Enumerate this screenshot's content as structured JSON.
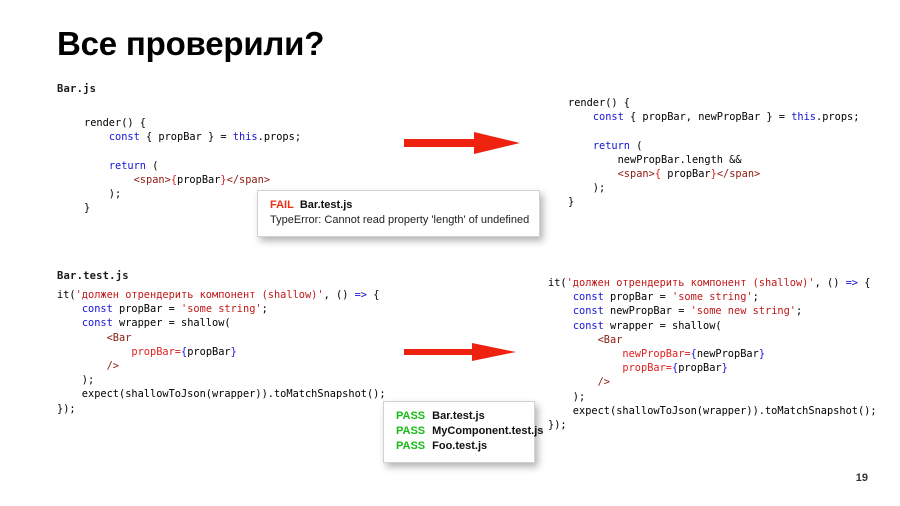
{
  "slide": {
    "title": "Все проверили?",
    "page_number": "19"
  },
  "labels": {
    "bar_js": "Bar.js",
    "bar_test_js": "Bar.test.js"
  },
  "code_blocks": {
    "left_top": {
      "name": "Bar.js original render",
      "lines": [
        "render() {",
        "    const { propBar } = this.props;",
        "",
        "    return (",
        "        <span>{propBar}</span>",
        "    );",
        "}"
      ]
    },
    "right_top": {
      "name": "Bar.js fixed render",
      "lines": [
        "render() {",
        "    const { propBar, newPropBar } = this.props;",
        "",
        "    return (",
        "        newPropBar.length &&",
        "        <span>{ propBar}</span>",
        "    );",
        "}"
      ]
    },
    "left_bottom": {
      "name": "Bar.test.js original test",
      "lines": [
        "it('должен отрендерить компонент (shallow)', () => {",
        "    const propBar = 'some string';",
        "    const wrapper = shallow(",
        "        <Bar",
        "            propBar={propBar}",
        "        />",
        "    );",
        "    expect(shallowToJson(wrapper)).toMatchSnapshot();",
        "});"
      ]
    },
    "right_bottom": {
      "name": "Bar.test.js updated test",
      "lines": [
        "it('должен отрендерить компонент (shallow)', () => {",
        "    const propBar = 'some string';",
        "    const newPropBar = 'some new string';",
        "    const wrapper = shallow(",
        "        <Bar",
        "            newPropBar={newPropBar}",
        "            propBar={propBar}",
        "        />",
        "    );",
        "    expect(shallowToJson(wrapper)).toMatchSnapshot();",
        "});"
      ]
    }
  },
  "fail_box": {
    "status": "FAIL",
    "file": "Bar.test.js",
    "message": "TypeError: Cannot read property 'length' of undefined"
  },
  "pass_box": {
    "rows": [
      {
        "status": "PASS",
        "file": "Bar.test.js"
      },
      {
        "status": "PASS",
        "file": "MyComponent.test.js"
      },
      {
        "status": "PASS",
        "file": "Foo.test.js"
      }
    ]
  },
  "arrows": {
    "top_label": "transform-arrow-top",
    "bottom_label": "transform-arrow-bottom"
  },
  "colors": {
    "keyword": "#1414d6",
    "tag": "#8b1a10",
    "attribute": "#e02020",
    "string": "#c01818",
    "fail": "#ef2f13",
    "pass": "#17bb17",
    "arrow": "#ef2210"
  }
}
